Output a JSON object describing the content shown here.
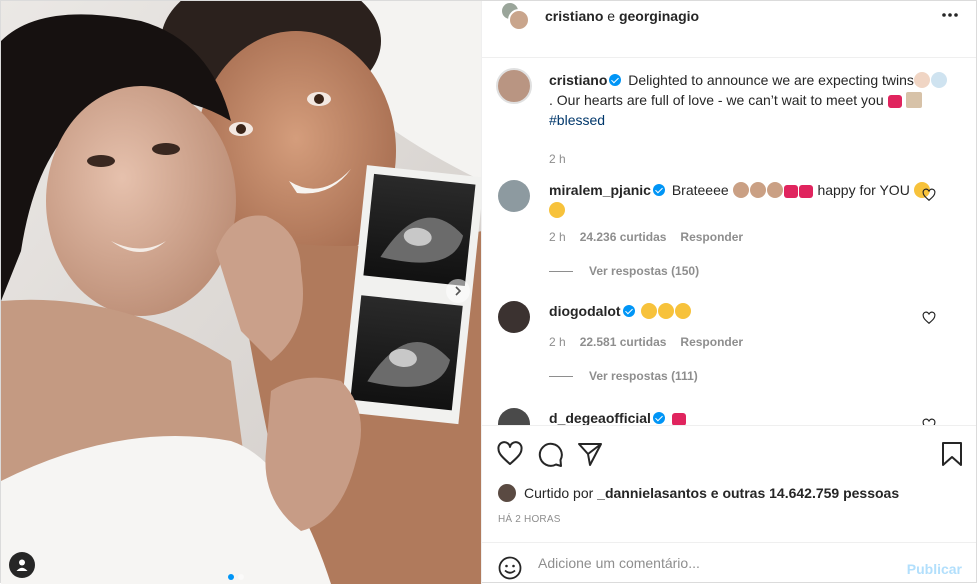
{
  "header": {
    "user1": "cristiano",
    "connector": "e",
    "user2": "georginagio"
  },
  "caption": {
    "user": "cristiano",
    "text1": "Delighted to announce we are expecting twins",
    "text2": ". Our hearts are full of love - we can’t wait to meet you",
    "hashtag": "#blessed",
    "time": "2 h"
  },
  "comments": [
    {
      "user": "miralem_pjanic",
      "text_before": "Brateeee",
      "text_after": "happy for YOU",
      "time": "2 h",
      "likes": "24.236 curtidas",
      "reply": "Responder",
      "view_replies": "Ver respostas (150)"
    },
    {
      "user": "diogodalot",
      "time": "2 h",
      "likes": "22.581 curtidas",
      "reply": "Responder",
      "view_replies": "Ver respostas (111)"
    },
    {
      "user": "d_degeaofficial"
    }
  ],
  "likes": {
    "prefix": "Curtido por",
    "user": "_dannielasantos",
    "suffix": "e outras 14.642.759 pessoas"
  },
  "timestamp": "HÁ 2 HORAS",
  "add_comment": {
    "placeholder": "Adicione um comentário...",
    "publish_label": "Publicar"
  },
  "colors": {
    "accent": "#0095f6",
    "like_red": "#ed4956",
    "publish_disabled": "#b2dffc"
  }
}
